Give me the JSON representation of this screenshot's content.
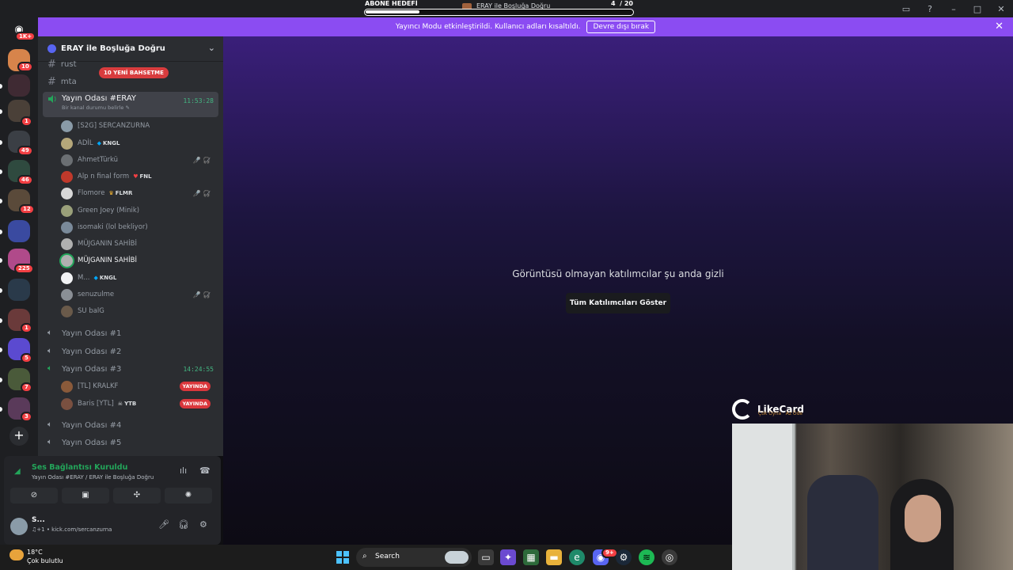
{
  "subgoal": {
    "label": "ABONE HEDEFİ",
    "server_name": "ERAY ile Boşluğa Doğru",
    "count": "4",
    "total": "/ 20",
    "progress": 0.2
  },
  "banner": {
    "text": "Yayıncı Modu etkinleştirildi. Kullanıcı adları kısaltıldı.",
    "button": "Devre dışı bırak",
    "close": "✕"
  },
  "rail": {
    "dm_badge": "1K+",
    "badges": [
      "10",
      "1",
      "49",
      "46",
      "12",
      "225",
      "1",
      "5",
      "7",
      "3"
    ],
    "add_icon": "+"
  },
  "sidebar": {
    "guild_name": "ERAY ile Boşluğa Doğru",
    "chevron": "⌄",
    "mention_pill": "10 YENİ BAHSETME",
    "channels": {
      "rust": "rust",
      "mta": "mta",
      "active_name": "Yayın Odası #ERAY",
      "active_time": "11:53:28",
      "active_status": "Bir kanal durumu belirle ✎",
      "room1": "Yayın Odası #1",
      "room2": "Yayın Odası #2",
      "room3": "Yayın Odası #3",
      "room3_time": "14:24:55",
      "room4": "Yayın Odası #4",
      "room5": "Yayın Odası #5"
    },
    "users": [
      {
        "name": "[S2G] SERCANZURNA",
        "tag": "",
        "icons": "",
        "live": ""
      },
      {
        "name": "ADİL",
        "tag": "KNGL",
        "icons": "",
        "live": ""
      },
      {
        "name": "AhmetTürkü",
        "tag": "",
        "icons": "🎤̸ 🎧̸",
        "live": ""
      },
      {
        "name": "Alp n final form",
        "tag": "FNL",
        "icons": "",
        "live": ""
      },
      {
        "name": "Flomore",
        "tag": "FLMR",
        "icons": "🎤̸ 🎧̸",
        "live": ""
      },
      {
        "name": "Green Joey (Minik)",
        "tag": "",
        "icons": "",
        "live": ""
      },
      {
        "name": "isomaki (lol bekliyor)",
        "tag": "",
        "icons": "",
        "live": ""
      },
      {
        "name": "MÜJGANIN SAHİBİ",
        "tag": "",
        "icons": "",
        "live": ""
      },
      {
        "name": "MÜJGANIN SAHİBİ",
        "tag": "",
        "icons": "",
        "live": ""
      },
      {
        "name": "M...",
        "tag": "KNGL",
        "icons": "",
        "live": ""
      },
      {
        "name": "senuzulme",
        "tag": "",
        "icons": "🎤̸ 🎧̸",
        "live": ""
      },
      {
        "name": "SU balG",
        "tag": "",
        "icons": "",
        "live": ""
      }
    ],
    "room3_users": [
      {
        "name": "[TL] KRALKF",
        "tag": "",
        "live": "YAYINDA"
      },
      {
        "name": "Baris [YTL]",
        "tag": "YTB",
        "live": "YAYINDA"
      }
    ]
  },
  "voice": {
    "status": "Ses Bağlantısı Kuruldu",
    "sub": "Yayın Odası #ERAY / ERAY ile Boşluğa Doğru",
    "user_name": "S...",
    "user_sub": "♫+1 • kick.com/sercanzurna"
  },
  "stage": {
    "message": "Görüntüsü olmayan katılımcılar şu anda gizli",
    "button": "Tüm Katılımcıları Göster"
  },
  "overlay": {
    "brand": "LikeCard",
    "slogan": "Çok Oyna · Az Öde"
  },
  "taskbar": {
    "temp": "18°C",
    "weather": "Çok bulutlu",
    "search": "Search",
    "discord_badge": "9+"
  },
  "colors": {
    "banner": "#8b4cf2",
    "live": "#da373c",
    "voice_green": "#23a55a"
  }
}
